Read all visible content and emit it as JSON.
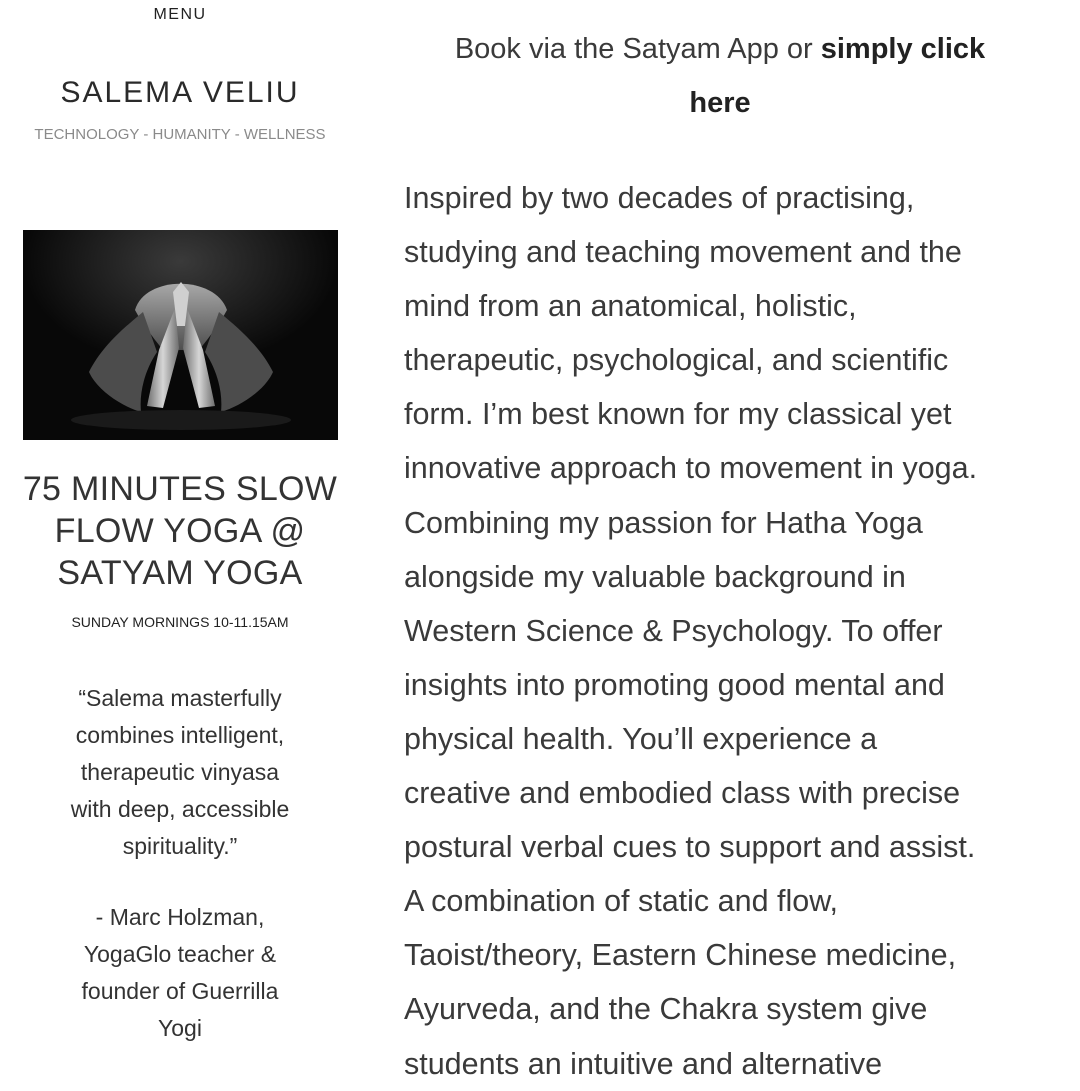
{
  "sidebar": {
    "menu_label": "MENU",
    "site_title": "SALEMA VELIU",
    "tagline": "TECHNOLOGY - HUMANITY - WELLNESS",
    "hero_image": {
      "icon": "yoga-pose-photo",
      "background_color": "#080808"
    },
    "class_title_lines": [
      "75 MINUTES SLOW",
      "FLOW YOGA @",
      "SATYAM YOGA"
    ],
    "class_time": "SUNDAY MORNINGS 10-11.15AM",
    "quote_lines": [
      "“Salema masterfully",
      "combines intelligent,",
      "therapeutic vinyasa",
      "with deep, accessible",
      "spirituality.”"
    ],
    "attribution_lines": [
      "- Marc Holzman,",
      "YogaGlo teacher &",
      "founder of Guerrilla",
      "Yogi"
    ]
  },
  "main": {
    "booking": {
      "prefix": "Book via the Satyam App or ",
      "link_text_1": "simply click",
      "link_text_2": "here"
    },
    "bio_lines": [
      "Inspired by two decades of practising,",
      "studying and teaching movement and the",
      "mind from an anatomical, holistic,",
      "therapeutic, psychological, and scientific",
      "form. I’m best known for my classical yet",
      "innovative approach to movement in yoga.",
      "Combining my passion for Hatha Yoga",
      "alongside my valuable background in",
      "Western Science & Psychology. To offer",
      "insights into promoting good mental and",
      "physical health. You’ll experience a",
      "creative and embodied class with precise",
      "postural verbal cues to support and assist.",
      "A combination of static and flow,",
      "Taoist/theory, Eastern Chinese medicine,",
      "Ayurveda, and the Chakra system give",
      "students an intuitive and alternative"
    ]
  }
}
